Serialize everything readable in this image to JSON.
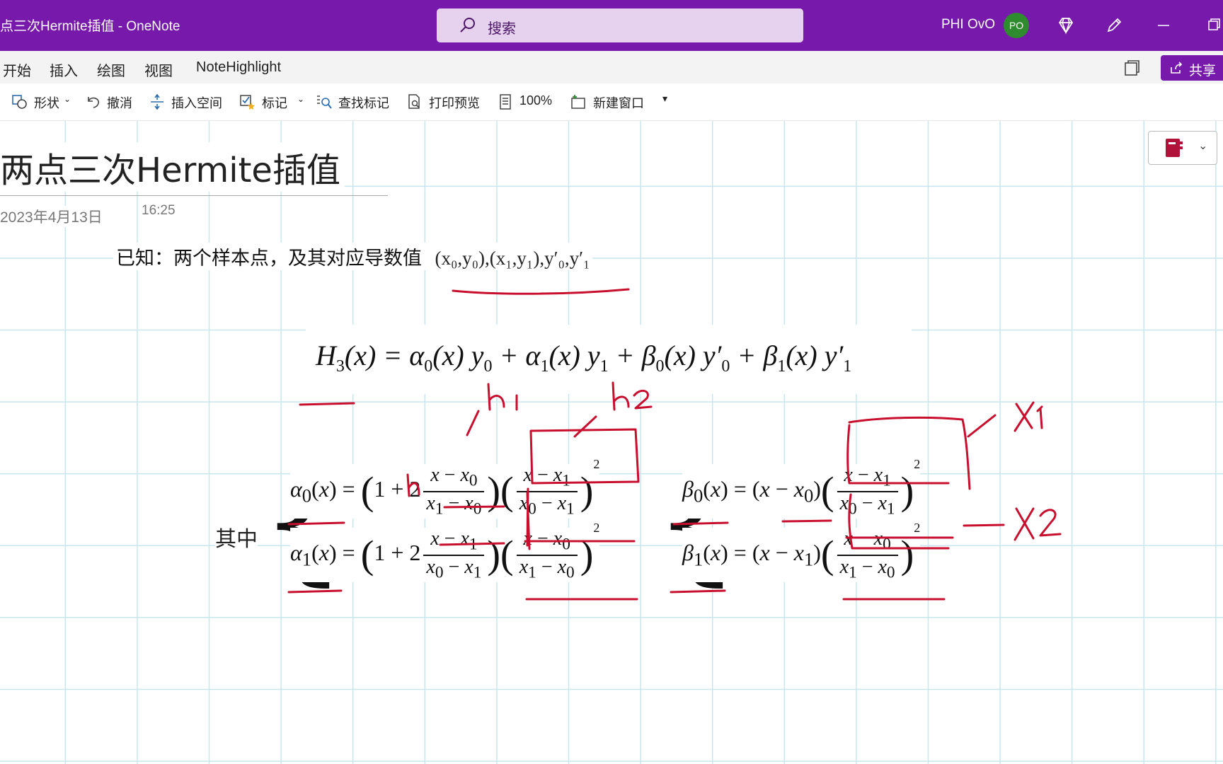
{
  "window": {
    "title": "点三次Hermite插值 - OneNote",
    "search_placeholder": "搜索",
    "user_name": "PHI OvO",
    "avatar_initials": "PO",
    "accent_color": "#7719aa"
  },
  "ribbon": {
    "tabs": [
      "开始",
      "插入",
      "绘图",
      "视图",
      "NoteHighlight"
    ],
    "share_label": "共享"
  },
  "toolbar": {
    "shapes": "形状",
    "undo": "撤消",
    "insert_space": "插入空间",
    "tag": "标记",
    "find_tags": "查找标记",
    "print_preview": "打印预览",
    "zoom": "100%",
    "new_window": "新建窗口"
  },
  "page": {
    "title": "两点三次Hermite插值",
    "date": "2023年4月13日",
    "time": "16:25",
    "known_label": "已知：两个样本点，及其对应导数值",
    "known_math": "(x₀,y₀),(x₁,y₁),y′₀,y′₁",
    "where_label": "其中"
  },
  "ink": {
    "annotations": [
      "h1",
      "h2",
      "h",
      "X1",
      "X2"
    ],
    "color": "#c8102e"
  }
}
